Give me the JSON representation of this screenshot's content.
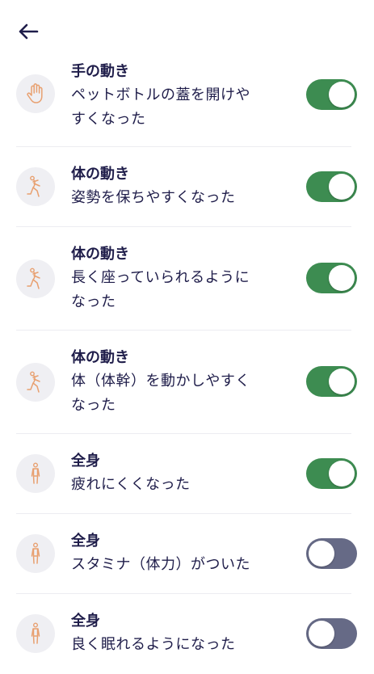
{
  "header": {
    "back_icon": "arrow-left-icon"
  },
  "colors": {
    "toggle_on": "#3d8c51",
    "toggle_off": "#666a86",
    "icon_accent": "#e8a070",
    "text": "#1f1d4a"
  },
  "items": [
    {
      "category": "手の動き",
      "lines": [
        "ペットボトルの蓋を開けや",
        "すくなった"
      ],
      "icon": "hand-icon",
      "enabled": true
    },
    {
      "category": "体の動き",
      "lines": [
        "姿勢を保ちやすくなった"
      ],
      "icon": "stretching-person-icon",
      "enabled": true
    },
    {
      "category": "体の動き",
      "lines": [
        "長く座っていられるように",
        "なった"
      ],
      "icon": "stretching-person-icon",
      "enabled": true
    },
    {
      "category": "体の動き",
      "lines": [
        "体（体幹）を動かしやすく",
        "なった"
      ],
      "icon": "stretching-person-icon",
      "enabled": true
    },
    {
      "category": "全身",
      "lines": [
        "疲れにくくなった"
      ],
      "icon": "standing-person-icon",
      "enabled": true
    },
    {
      "category": "全身",
      "lines": [
        "スタミナ（体力）がついた"
      ],
      "icon": "standing-person-icon",
      "enabled": false
    },
    {
      "category": "全身",
      "lines": [
        "良く眠れるようになった"
      ],
      "icon": "standing-person-icon",
      "enabled": false
    }
  ]
}
